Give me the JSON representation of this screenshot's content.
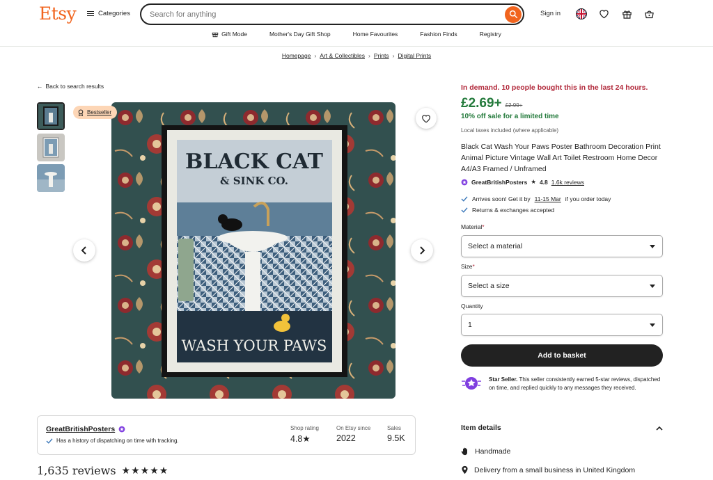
{
  "header": {
    "logo": "Etsy",
    "categories_label": "Categories",
    "search_placeholder": "Search for anything",
    "signin_label": "Sign in"
  },
  "subnav": [
    "Gift Mode",
    "Mother's Day Gift Shop",
    "Home Favourites",
    "Fashion Finds",
    "Registry"
  ],
  "breadcrumbs": [
    "Homepage",
    "Art & Collectibles",
    "Prints",
    "Digital Prints"
  ],
  "back_label": "Back to search results",
  "badge": {
    "label": "Bestseller"
  },
  "poster": {
    "line1": "BLACK CAT",
    "line2": "& SINK CO.",
    "bottom": "WASH YOUR PAWS"
  },
  "product": {
    "demand": "In demand. 10 people bought this in the last 24 hours.",
    "price": "£2.69+",
    "old_price": "£2.99+",
    "sale": "10% off sale for a limited time",
    "taxes": "Local taxes included (where applicable)",
    "title": "Black Cat Wash Your Paws Poster Bathroom Decoration Print Animal Picture Vintage Wall Art Toilet Restroom Home Decor A4/A3 Framed / Unframed",
    "seller": "GreatBritishPosters",
    "rating": "4.8",
    "reviews_link": "1.6k reviews",
    "arrives_prefix": "Arrives soon! Get it by",
    "arrives_dates": "11-15 Mar",
    "arrives_suffix": "if you order today",
    "returns": "Returns & exchanges accepted"
  },
  "form": {
    "material_label": "Material",
    "material_value": "Select a material",
    "size_label": "Size",
    "size_value": "Select a size",
    "quantity_label": "Quantity",
    "quantity_value": "1",
    "required_mark": "*",
    "basket_label": "Add to basket"
  },
  "star_seller": {
    "title": "Star Seller.",
    "text": "This seller consistently earned 5-star reviews, dispatched on time, and replied quickly to any messages they received."
  },
  "item_details": {
    "heading": "Item details",
    "rows": [
      "Handmade",
      "Delivery from a small business in United Kingdom"
    ]
  },
  "shop_card": {
    "name": "GreatBritishPosters",
    "note": "Has a history of dispatching on time with tracking.",
    "stats": [
      {
        "label": "Shop rating",
        "value": "4.8★"
      },
      {
        "label": "On Etsy since",
        "value": "2022"
      },
      {
        "label": "Sales",
        "value": "9.5K"
      }
    ]
  },
  "reviews": {
    "count": "1,635 reviews",
    "stars": "★★★★★"
  },
  "colors": {
    "brand": "#f1641e",
    "price_green": "#237a3b",
    "demand_red": "#b1283a",
    "star_seller_purple": "#7f3ee0"
  }
}
